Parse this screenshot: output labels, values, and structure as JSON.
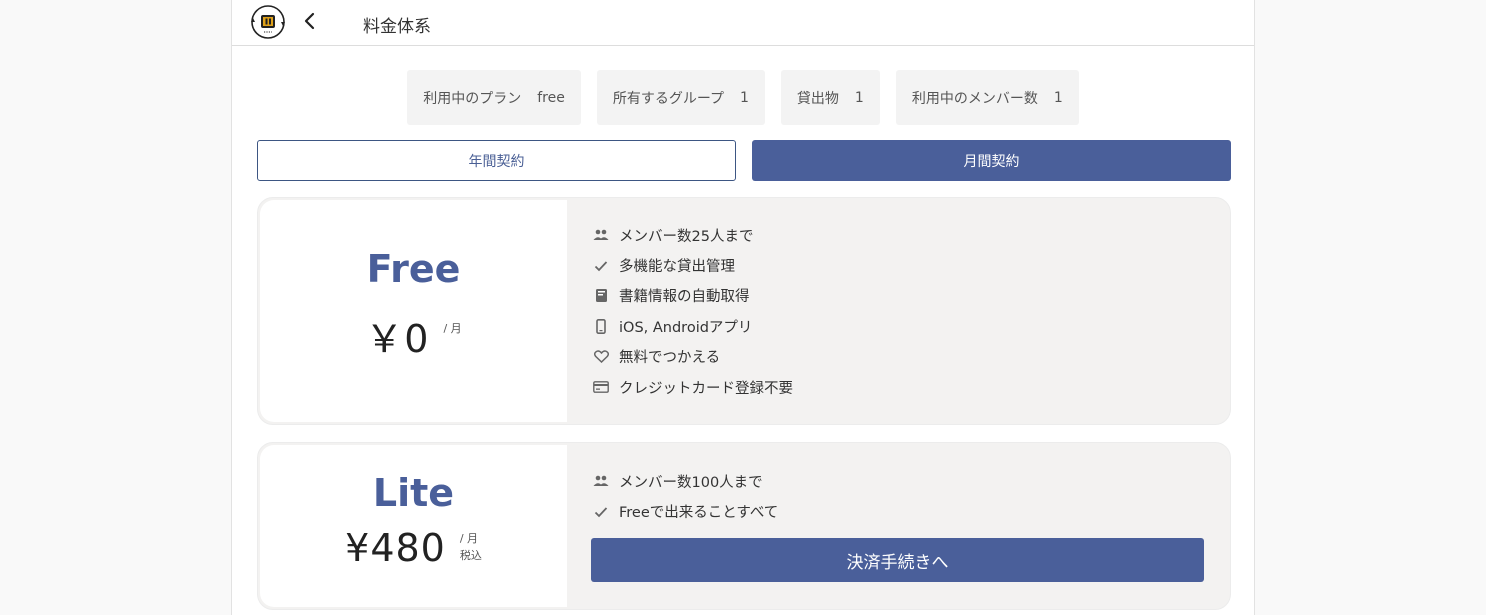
{
  "header": {
    "title": "料金体系"
  },
  "stats": [
    {
      "label": "利用中のプラン",
      "value": "free"
    },
    {
      "label": "所有するグループ",
      "value": "1"
    },
    {
      "label": "貸出物",
      "value": "1"
    },
    {
      "label": "利用中のメンバー数",
      "value": "1"
    }
  ],
  "toggle": {
    "annual_label": "年間契約",
    "monthly_label": "月間契約",
    "selected": "monthly"
  },
  "plans": [
    {
      "name": "Free",
      "price": "￥0",
      "unit": "/ 月",
      "tax": "",
      "features": [
        {
          "icon": "people-icon",
          "text": "メンバー数25人まで"
        },
        {
          "icon": "check-icon",
          "text": "多機能な貸出管理"
        },
        {
          "icon": "book-icon",
          "text": "書籍情報の自動取得"
        },
        {
          "icon": "phone-icon",
          "text": "iOS, Androidアプリ"
        },
        {
          "icon": "heart-icon",
          "text": "無料でつかえる"
        },
        {
          "icon": "credit-card-icon",
          "text": "クレジットカード登録不要"
        }
      ]
    },
    {
      "name": "Lite",
      "price": "¥480",
      "unit": "/ 月",
      "tax": "税込",
      "features": [
        {
          "icon": "people-icon",
          "text": "メンバー数100人まで"
        },
        {
          "icon": "check-icon",
          "text": "Freeで出来ることすべて"
        }
      ],
      "button_label": "決済手続きへ"
    }
  ],
  "colors": {
    "accent": "#4a5f9a",
    "card_bg": "#f3f2f1",
    "stat_bg": "#f3f3f3"
  }
}
